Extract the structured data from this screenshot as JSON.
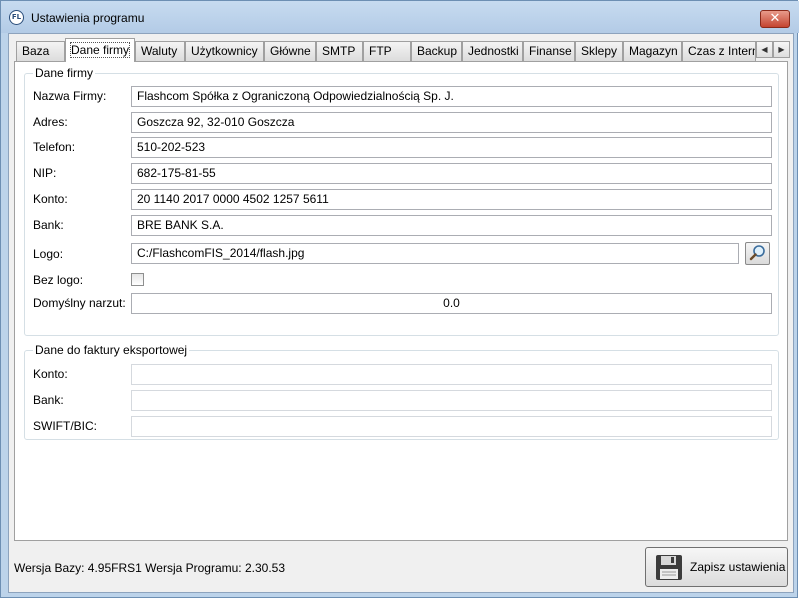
{
  "window": {
    "title": "Ustawienia programu",
    "app_icon_text": "FL",
    "close_glyph": "✕"
  },
  "tabs": [
    {
      "label": "Baza"
    },
    {
      "label": "Dane firmy"
    },
    {
      "label": "Waluty"
    },
    {
      "label": "Użytkownicy"
    },
    {
      "label": "Główne"
    },
    {
      "label": "SMTP"
    },
    {
      "label": "FTP"
    },
    {
      "label": "Backup"
    },
    {
      "label": "Jednostki"
    },
    {
      "label": "Finanse"
    },
    {
      "label": "Sklepy"
    },
    {
      "label": "Magazyn"
    },
    {
      "label": "Czas z Internetu"
    }
  ],
  "tab_scroll": {
    "left": "◀",
    "right": "▶"
  },
  "company": {
    "title": "Dane firmy",
    "name_label": "Nazwa Firmy:",
    "name_value": "Flashcom Spółka z Ograniczoną Odpowiedzialnością Sp. J.",
    "address_label": "Adres:",
    "address_value": "Goszcza 92, 32-010 Goszcza",
    "phone_label": "Telefon:",
    "phone_value": "510-202-523",
    "nip_label": "NIP:",
    "nip_value": "682-175-81-55",
    "account_label": "Konto:",
    "account_value": "20 1140 2017 0000 4502 1257 5611",
    "bank_label": "Bank:",
    "bank_value": "BRE BANK S.A.",
    "logo_label": "Logo:",
    "logo_value": "C:/FlashcomFIS_2014/flash.jpg",
    "no_logo_label": "Bez logo:",
    "markup_label": "Domyślny narzut:",
    "markup_value": "0.0"
  },
  "export": {
    "title": "Dane do faktury eksportowej",
    "account_label": "Konto:",
    "account_value": "",
    "bank_label": "Bank:",
    "bank_value": "",
    "swift_label": "SWIFT/BIC:",
    "swift_value": ""
  },
  "footer": {
    "version_text": "Wersja Bazy: 4.95FRS1 Wersja Programu: 2.30.53",
    "save_label": "Zapisz ustawienia"
  },
  "icons": {
    "browse": "magnifier-icon",
    "save": "floppy-disk-icon"
  }
}
